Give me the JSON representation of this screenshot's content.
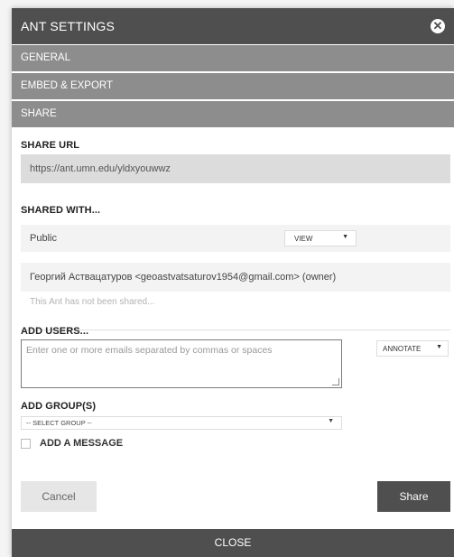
{
  "modal": {
    "title": "ANT SETTINGS",
    "close_icon": "close-circle-icon"
  },
  "accordion": {
    "general": "GENERAL",
    "embed_export": "EMBED & EXPORT",
    "share": "SHARE"
  },
  "share_url": {
    "label": "SHARE URL",
    "value": "https://ant.umn.edu/yldxyouwwz"
  },
  "shared_with": {
    "label": "SHARED WITH...",
    "public_label": "Public",
    "public_permission": "VIEW",
    "owner_entry": "Георгий Аствацатуров <geoastvatsaturov1954@gmail.com> (owner)",
    "not_shared_note": "This Ant has not been shared..."
  },
  "add_users": {
    "label": "ADD USERS...",
    "placeholder": "Enter one or more emails separated by commas or spaces",
    "permission": "ANNOTATE"
  },
  "add_groups": {
    "label": "ADD GROUP(S)",
    "selected": "-- SELECT GROUP --"
  },
  "message": {
    "label": "ADD A MESSAGE"
  },
  "actions": {
    "cancel": "Cancel",
    "share": "Share",
    "close": "CLOSE"
  },
  "colors": {
    "header_bg": "#4f4f4f",
    "accordion_bg": "#8d8d8d",
    "url_bg": "#dcdcdc"
  }
}
